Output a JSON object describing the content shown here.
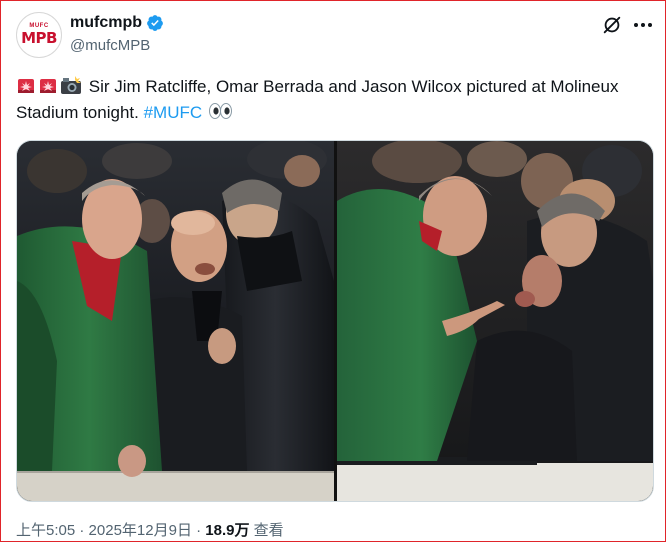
{
  "account": {
    "display_name": "mufcmpb",
    "handle": "@mufcMPB",
    "avatar_text": "MPB",
    "avatar_subtext": "MUFC"
  },
  "header": {
    "grok_icon": "grok-icon",
    "more_icon": "more-icon",
    "verified_icon": "verified-badge-icon",
    "verified_color": "#1d9bf0"
  },
  "tweet": {
    "text": "Sir Jim Ratcliffe, Omar Berrada and Jason Wilcox pictured at Molineux Stadium tonight.",
    "hashtag": "#MUFC",
    "emoji_prefix": [
      "siren-icon",
      "siren-icon",
      "camera-flash-icon"
    ],
    "emoji_suffix": "eyes-icon"
  },
  "media": {
    "images": [
      {
        "name": "photo-left"
      },
      {
        "name": "photo-right"
      }
    ]
  },
  "meta": {
    "time": "上午5:05",
    "separator": " · ",
    "date": "2025年12月9日",
    "views_count": "18.9万",
    "views_label": "查看"
  },
  "colors": {
    "text": "#0f1419",
    "muted": "#536471",
    "link": "#1d9bf0",
    "border": "#cfd9de"
  }
}
